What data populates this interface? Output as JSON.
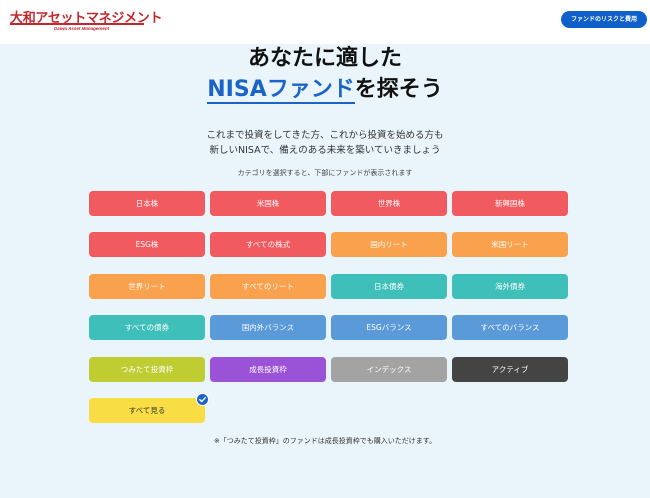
{
  "header": {
    "logo_text": "大和アセットマネジメント",
    "logo_sub": "Daiwa Asset Management",
    "risk_button": "ファンドのリスクと費用"
  },
  "hero": {
    "title_line1": "あなたに適した",
    "title_accent": "NISAファンド",
    "title_rest": "を探そう",
    "lead_line1": "これまで投資をしてきた方、これから投資を始める方も",
    "lead_line2": "新しいNISAで、備えのある未来を築いていきましょう",
    "hint": "カテゴリを選択すると、下部にファンドが表示されます"
  },
  "categories": [
    "日本株",
    "米国株",
    "世界株",
    "新興国株",
    "ESG株",
    "すべての株式",
    "国内リート",
    "米国リート",
    "世界リート",
    "すべてのリート",
    "日本債券",
    "海外債券",
    "すべての債券",
    "国内外バランス",
    "ESGバランス",
    "すべてのバランス",
    "つみたて投資枠",
    "成長投資枠",
    "インデックス",
    "アクティブ",
    "すべて見る"
  ],
  "colors": {
    "stocks": "#f15a5f",
    "reits": "#f9a14d",
    "bonds": "#3fbfb9",
    "balance": "#5b9ad9",
    "tsumitate": "#bfcd33",
    "growth": "#9a52d6",
    "index": "#a3a3a3",
    "active": "#444444",
    "all": "#f9dd45",
    "accent": "#1a64c8"
  },
  "selected": "すべて見る",
  "note": "※「つみたて投資枠」のファンドは成長投資枠でも購入いただけます。"
}
